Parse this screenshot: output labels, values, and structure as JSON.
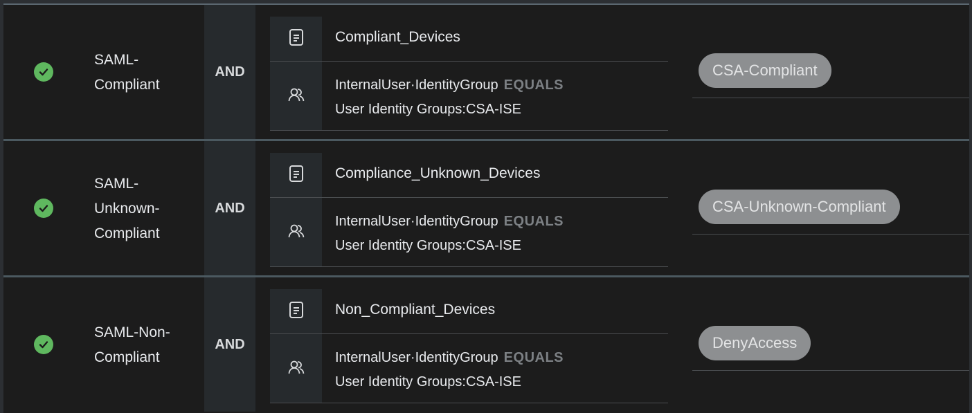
{
  "rules": [
    {
      "name_lines": [
        "SAML-",
        "Compliant"
      ],
      "operator": "AND",
      "condition_name": "Compliant_Devices",
      "attribute": "InternalUser·IdentityGroup",
      "comparison": "EQUALS",
      "value": "User Identity Groups:CSA-ISE",
      "result": "CSA-Compliant"
    },
    {
      "name_lines": [
        "SAML-",
        "Unknown-",
        "Compliant"
      ],
      "operator": "AND",
      "condition_name": "Compliance_Unknown_Devices",
      "attribute": "InternalUser·IdentityGroup",
      "comparison": "EQUALS",
      "value": "User Identity Groups:CSA-ISE",
      "result": "CSA-Unknown-Compliant"
    },
    {
      "name_lines": [
        "SAML-Non-",
        "Compliant"
      ],
      "operator": "AND",
      "condition_name": "Non_Compliant_Devices",
      "attribute": "InternalUser·IdentityGroup",
      "comparison": "EQUALS",
      "value": "User Identity Groups:CSA-ISE",
      "result": "DenyAccess"
    }
  ],
  "icons": {
    "status": "check-circle-icon",
    "condition": "document-icon",
    "identity": "user-group-icon"
  },
  "colors": {
    "status_ok": "#5fb85f",
    "pill_bg": "#8d8f91",
    "comparison_text": "#7c8084"
  }
}
